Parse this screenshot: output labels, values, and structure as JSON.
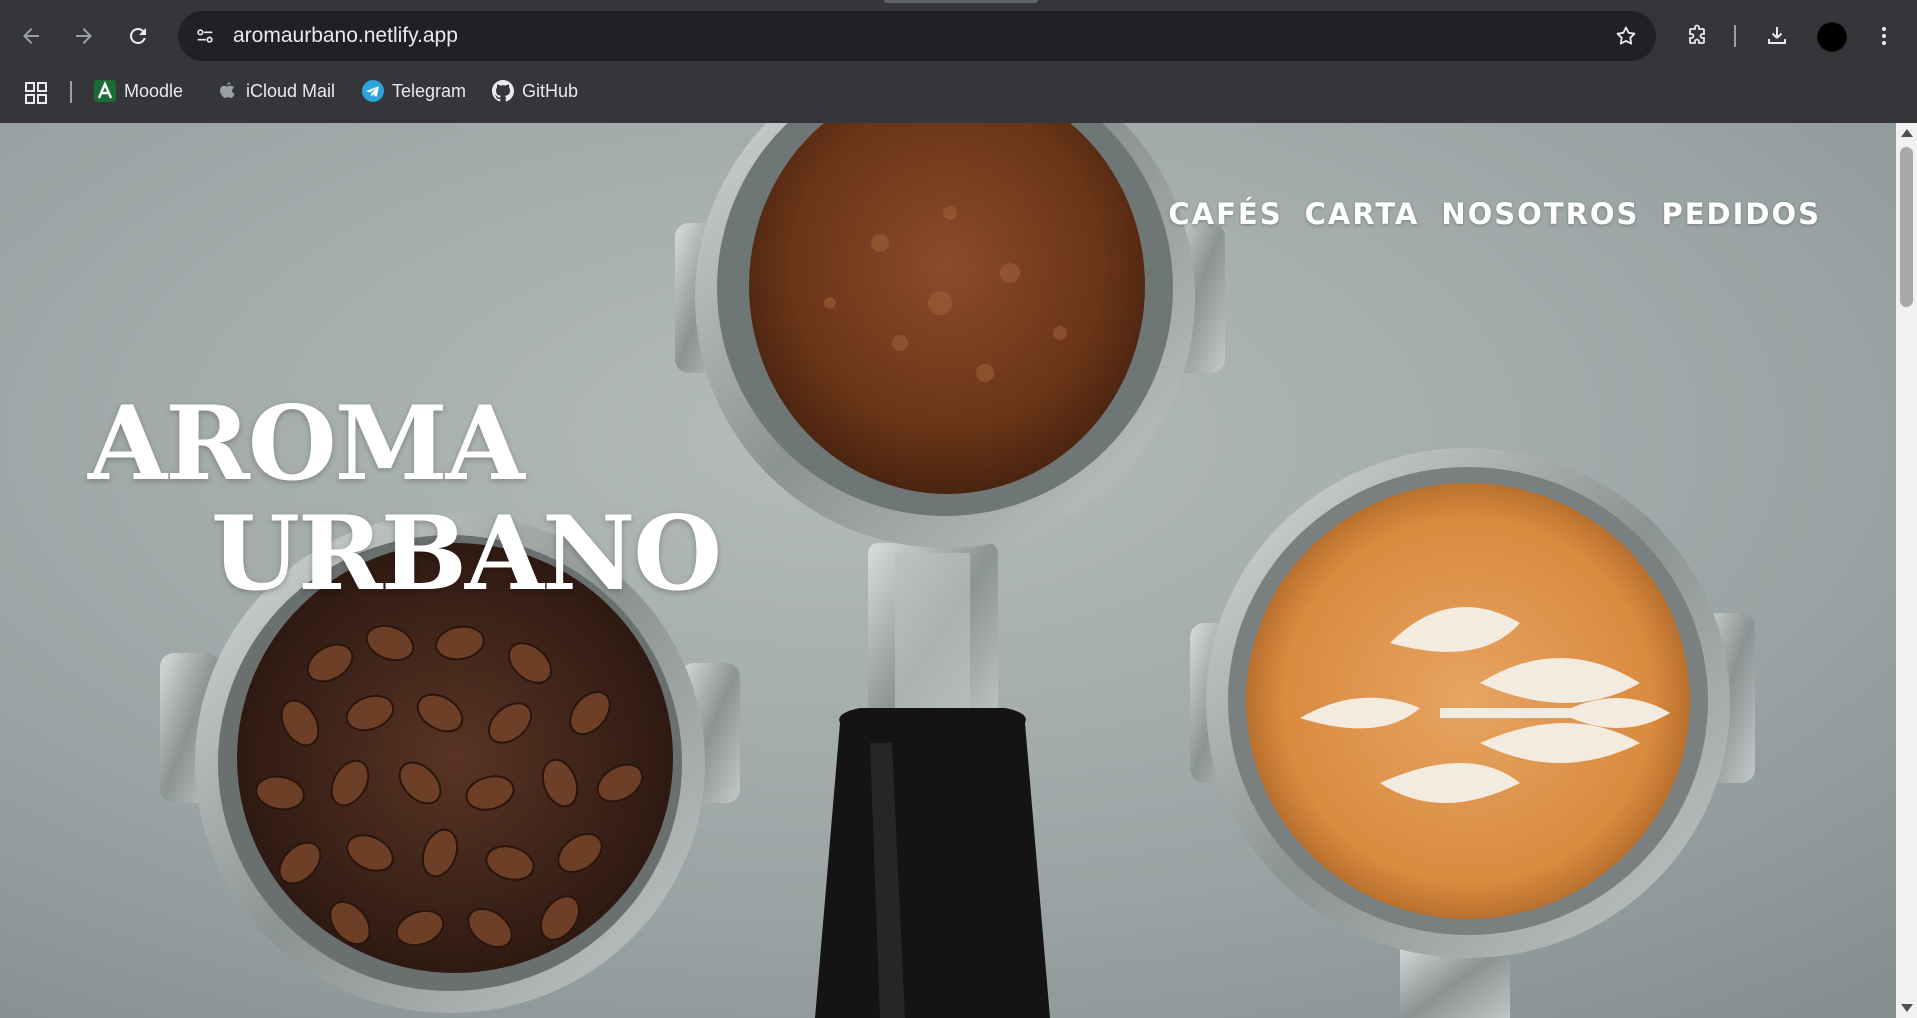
{
  "browser": {
    "url": "aromaurbano.netlify.app",
    "icons": {
      "back": "arrow-left-icon",
      "forward": "arrow-right-icon",
      "reload": "reload-icon",
      "site_info": "tune-icon",
      "bookmark_star": "star-icon",
      "extensions": "puzzle-icon",
      "downloads": "download-icon",
      "menu": "kebab-menu-icon",
      "apps": "apps-grid-icon"
    },
    "bookmarks": [
      {
        "label": "Moodle",
        "icon": "moodle-icon"
      },
      {
        "label": "iCloud Mail",
        "icon": "apple-icon"
      },
      {
        "label": "Telegram",
        "icon": "telegram-icon"
      },
      {
        "label": "GitHub",
        "icon": "github-icon"
      }
    ]
  },
  "page": {
    "nav": [
      "CAFÉS",
      "CARTA",
      "NOSOTROS",
      "PEDIDOS"
    ],
    "title_line1": "AROMA",
    "title_line2": "URBANO",
    "hero_image": "coffee-portafilters-photo"
  },
  "colors": {
    "chrome_bg": "#35363a",
    "omnibox_bg": "#202124",
    "chrome_text": "#e8eaed",
    "hero_text": "#ffffff"
  }
}
